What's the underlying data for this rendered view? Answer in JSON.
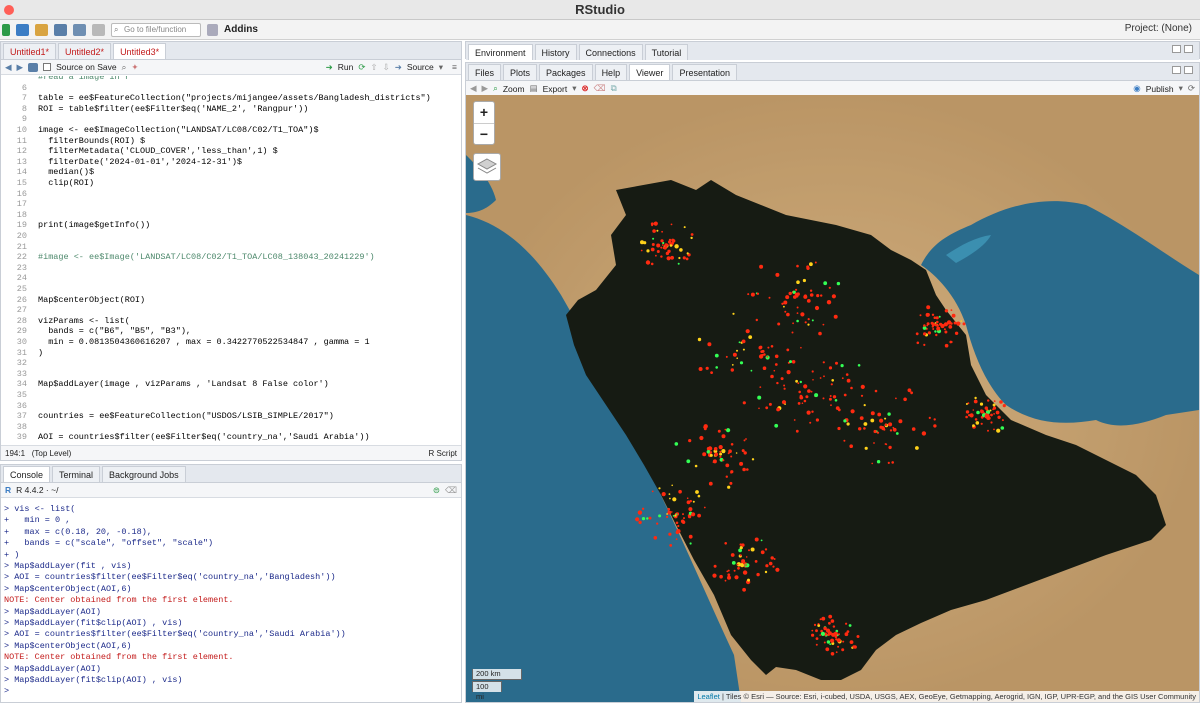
{
  "app": {
    "title": "RStudio",
    "project": "Project: (None)"
  },
  "toolbar": {
    "goto_placeholder": "Go to file/function",
    "addins": "Addins"
  },
  "editor": {
    "tabs": [
      {
        "label": "Untitled1*"
      },
      {
        "label": "Untitled2*"
      },
      {
        "label": "Untitled3*"
      }
    ],
    "source_on_save": "Source on Save",
    "run": "Run",
    "source": "Source",
    "lines": [
      {
        "n": "",
        "t": "#read a image in r"
      },
      {
        "n": "6",
        "t": ""
      },
      {
        "n": "7",
        "t": "table = ee$FeatureCollection(\"projects/mijangee/assets/Bangladesh_districts\")"
      },
      {
        "n": "8",
        "t": "ROI = table$filter(ee$Filter$eq('NAME_2', 'Rangpur'))"
      },
      {
        "n": "9",
        "t": ""
      },
      {
        "n": "10",
        "t": "image <- ee$ImageCollection(\"LANDSAT/LC08/C02/T1_TOA\")$"
      },
      {
        "n": "11",
        "t": "  filterBounds(ROI) $"
      },
      {
        "n": "12",
        "t": "  filterMetadata('CLOUD_COVER','less_than',1) $"
      },
      {
        "n": "13",
        "t": "  filterDate('2024-01-01','2024-12-31')$"
      },
      {
        "n": "14",
        "t": "  median()$"
      },
      {
        "n": "15",
        "t": "  clip(ROI)"
      },
      {
        "n": "16",
        "t": ""
      },
      {
        "n": "17",
        "t": ""
      },
      {
        "n": "18",
        "t": ""
      },
      {
        "n": "19",
        "t": "print(image$getInfo())"
      },
      {
        "n": "20",
        "t": ""
      },
      {
        "n": "21",
        "t": ""
      },
      {
        "n": "22",
        "t": "#image <- ee$Image('LANDSAT/LC08/C02/T1_TOA/LC08_138043_20241229')"
      },
      {
        "n": "23",
        "t": ""
      },
      {
        "n": "24",
        "t": ""
      },
      {
        "n": "25",
        "t": ""
      },
      {
        "n": "26",
        "t": "Map$centerObject(ROI)"
      },
      {
        "n": "27",
        "t": ""
      },
      {
        "n": "28",
        "t": "vizParams <- list("
      },
      {
        "n": "29",
        "t": "  bands = c(\"B6\", \"B5\", \"B3\"),"
      },
      {
        "n": "30",
        "t": "  min = 0.0813504360616207 , max = 0.3422770522534847 , gamma = 1"
      },
      {
        "n": "31",
        "t": ")"
      },
      {
        "n": "32",
        "t": ""
      },
      {
        "n": "33",
        "t": ""
      },
      {
        "n": "34",
        "t": "Map$addLayer(image , vizParams , 'Landsat 8 False color')"
      },
      {
        "n": "35",
        "t": ""
      },
      {
        "n": "36",
        "t": ""
      },
      {
        "n": "37",
        "t": "countries = ee$FeatureCollection(\"USDOS/LSIB_SIMPLE/2017\")"
      },
      {
        "n": "38",
        "t": ""
      },
      {
        "n": "39",
        "t": "AOI = countries$filter(ee$Filter$eq('country_na','Saudi Arabia'))"
      }
    ],
    "status_pos": "194:1",
    "status_scope": "(Top Level)",
    "status_type": "R Script"
  },
  "console": {
    "tabs": [
      {
        "label": "Console"
      },
      {
        "label": "Terminal"
      },
      {
        "label": "Background Jobs"
      }
    ],
    "version": "R 4.4.2 · ~/",
    "lines": [
      {
        "t": "> vis <- list(",
        "note": false
      },
      {
        "t": "+   min = 0 ,",
        "note": false
      },
      {
        "t": "+   max = c(0.18, 20, -0.18),",
        "note": false
      },
      {
        "t": "+   bands = c(\"scale\", \"offset\", \"scale\")",
        "note": false
      },
      {
        "t": "+ )",
        "note": false
      },
      {
        "t": "> Map$addLayer(fit , vis)",
        "note": false
      },
      {
        "t": "> AOI = countries$filter(ee$Filter$eq('country_na','Bangladesh'))",
        "note": false
      },
      {
        "t": "> Map$centerObject(AOI,6)",
        "note": false
      },
      {
        "t": "NOTE: Center obtained from the first element.",
        "note": true
      },
      {
        "t": "> Map$addLayer(AOI)",
        "note": false
      },
      {
        "t": "> Map$addLayer(fit$clip(AOI) , vis)",
        "note": false
      },
      {
        "t": "> AOI = countries$filter(ee$Filter$eq('country_na','Saudi Arabia'))",
        "note": false
      },
      {
        "t": "> Map$centerObject(AOI,6)",
        "note": false
      },
      {
        "t": "NOTE: Center obtained from the first element.",
        "note": true
      },
      {
        "t": "> Map$addLayer(AOI)",
        "note": false
      },
      {
        "t": "> Map$addLayer(fit$clip(AOI) , vis)",
        "note": false
      },
      {
        "t": ">",
        "note": false
      }
    ]
  },
  "env": {
    "tabs": [
      {
        "label": "Environment"
      },
      {
        "label": "History"
      },
      {
        "label": "Connections"
      },
      {
        "label": "Tutorial"
      }
    ]
  },
  "viewer": {
    "tabs": [
      {
        "label": "Files"
      },
      {
        "label": "Plots"
      },
      {
        "label": "Packages"
      },
      {
        "label": "Help"
      },
      {
        "label": "Viewer"
      },
      {
        "label": "Presentation"
      }
    ],
    "zoom": "Zoom",
    "export": "Export",
    "publish": "Publish",
    "zoom_in": "+",
    "zoom_out": "−",
    "scale_km": "200 km",
    "scale_mi": "100 mi",
    "attribution_link": "Leaflet",
    "attribution": " | Tiles © Esri — Source: Esri, i-cubed, USDA, USGS, AEX, GeoEye, Getmapping, Aerogrid, IGN, IGP, UPR-EGP, and the GIS User Community"
  },
  "colors": {
    "accent": "#3c7dc4",
    "modified_tab": "#c31b1b",
    "land": "#c9a474",
    "sea": "#2a6b8c",
    "mask": "#161b13"
  }
}
